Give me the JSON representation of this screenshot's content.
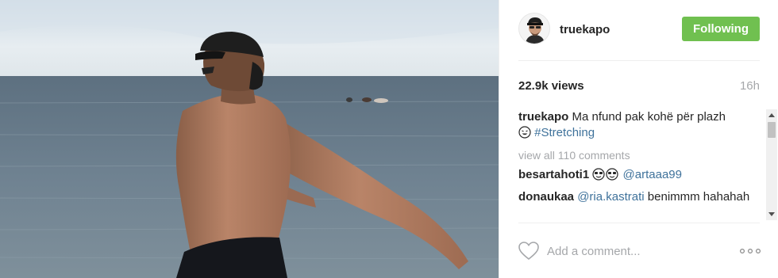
{
  "post": {
    "author": "truekapo",
    "follow_label": "Following",
    "views": "22.9k views",
    "time_ago": "16h",
    "caption": {
      "user": "truekapo",
      "text": "Ma nfund pak kohë për plazh",
      "hashtag": "#Stretching"
    },
    "view_all_label": "view all 110 comments",
    "comments": [
      {
        "user": "besartahoti1",
        "mention": "@artaaa99",
        "text": ""
      },
      {
        "user": "donaukaa",
        "mention": "@ria.kastrati",
        "text": "benimmm hahahah"
      }
    ],
    "add_comment_placeholder": "Add a comment..."
  },
  "colors": {
    "follow_button": "#70c050",
    "link": "#3f729b",
    "muted": "#a5a7aa",
    "text": "#262626"
  },
  "icons": {
    "like": "heart-icon",
    "more": "more-options-icon",
    "emoji": "emoji-icon"
  }
}
